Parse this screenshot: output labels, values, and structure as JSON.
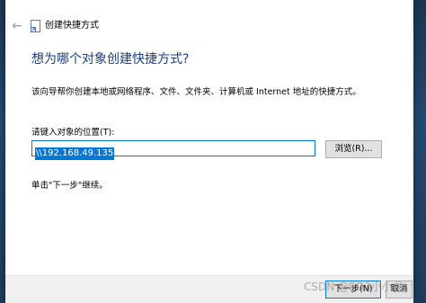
{
  "window": {
    "title": "创建快捷方式",
    "back_icon": "back-arrow-icon",
    "title_icon": "shortcut-icon"
  },
  "main": {
    "heading": "想为哪个对象创建快捷方式?",
    "description": "该向导帮你创建本地或网络程序、文件、文件夹、计算机或 Internet 地址的快捷方式。",
    "location_label": "请键入对象的位置(T):",
    "location_value": "\\\\192.168.49.135",
    "browse_label": "浏览(R)...",
    "hint": "单击\"下一步\"继续。"
  },
  "footer": {
    "next_label": "下一步(N)",
    "cancel_label": "取消"
  },
  "watermark": "CSDN @SO3小小龙",
  "colors": {
    "accent": "#0078d7",
    "heading": "#1a3e7a"
  }
}
